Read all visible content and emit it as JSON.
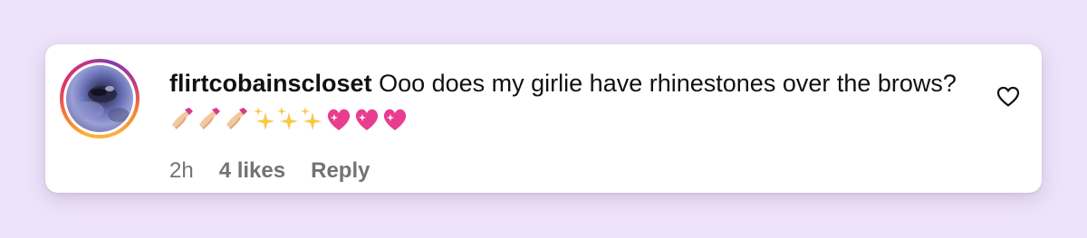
{
  "comment": {
    "username": "flirtcobainscloset",
    "text": "Ooo does my girlie have rhinestones over the brows?",
    "emojis": "💅🏼💅🏼💅🏼✨✨✨💖💖💖",
    "time": "2h",
    "likes": "4 likes",
    "reply_label": "Reply"
  },
  "icons": {
    "like": "heart-outline-icon",
    "avatar_ring": "story-ring"
  },
  "colors": {
    "background": "#efe3fb",
    "card": "#ffffff",
    "text": "#111111",
    "meta": "#737373",
    "nail_polish": "#d63c8a",
    "sparkle": "#f7c948",
    "heart": "#e93d8f"
  }
}
